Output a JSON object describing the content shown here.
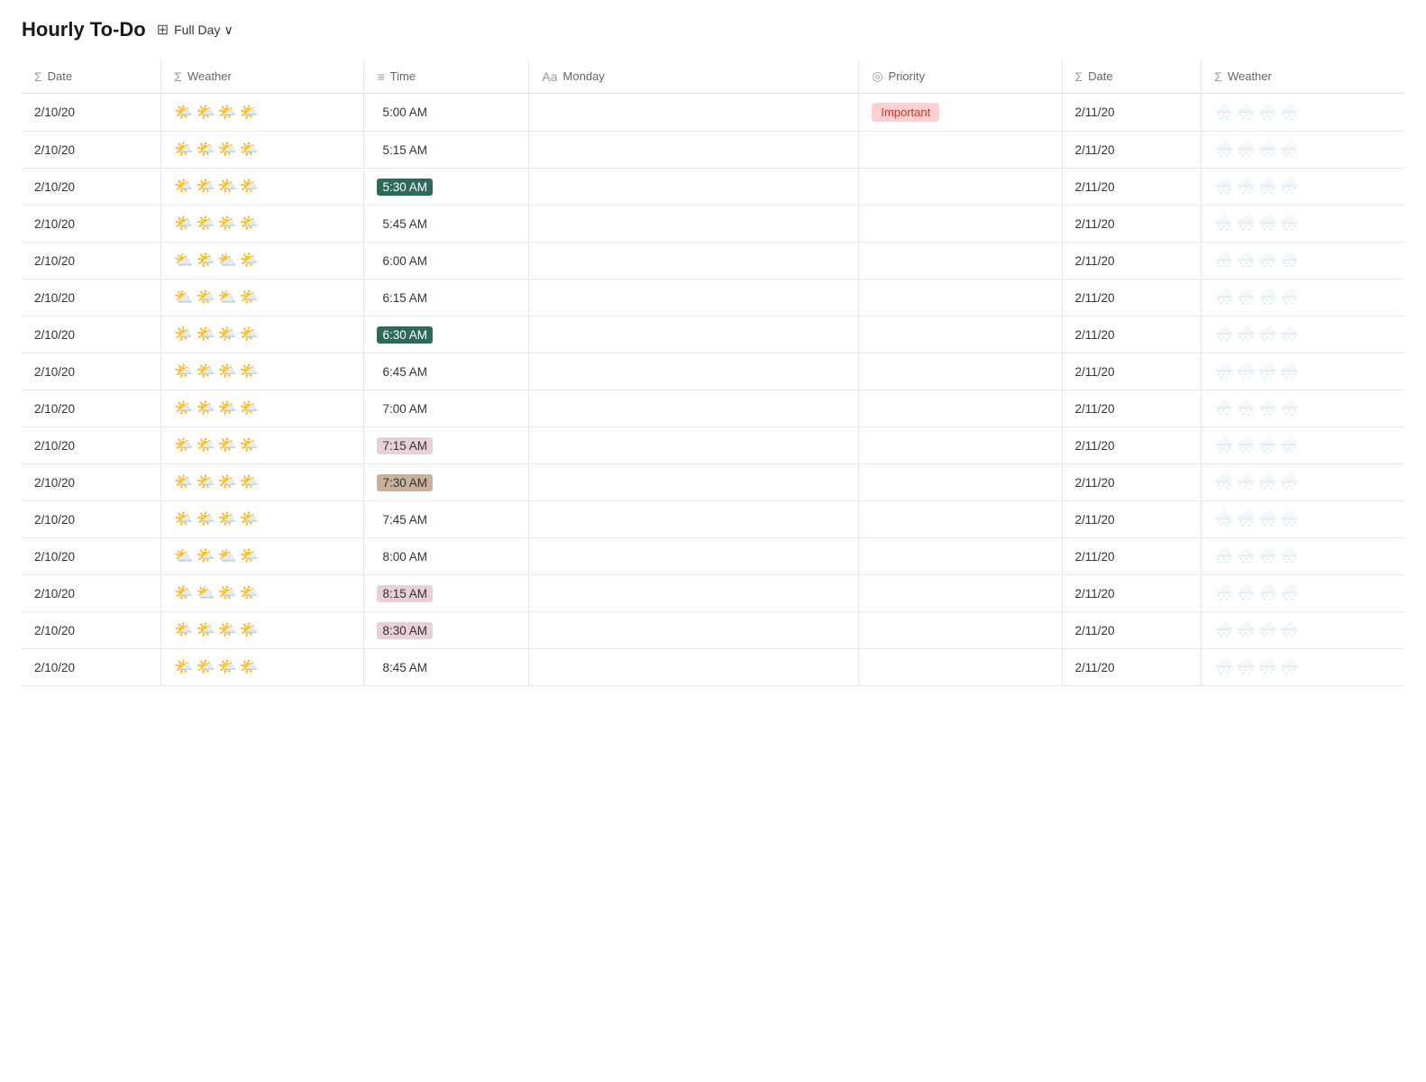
{
  "header": {
    "title": "Hourly To-Do",
    "grid_icon": "⊞",
    "view_label": "Full Day",
    "chevron": "∨"
  },
  "columns": [
    {
      "id": "date1",
      "icon": "Σ",
      "label": "Date"
    },
    {
      "id": "weather1",
      "icon": "Σ",
      "label": "Weather"
    },
    {
      "id": "time",
      "icon": "≡",
      "label": "Time"
    },
    {
      "id": "monday",
      "icon": "Aa",
      "label": "Monday"
    },
    {
      "id": "priority",
      "icon": "◎",
      "label": "Priority"
    },
    {
      "id": "date2",
      "icon": "Σ",
      "label": "Date"
    },
    {
      "id": "weather2",
      "icon": "Σ",
      "label": "Weather"
    }
  ],
  "rows": [
    {
      "date1": "2/10/20",
      "weather1": "sunny",
      "time": "5:00 AM",
      "time_style": "normal",
      "monday": "",
      "priority": "Important",
      "date2": "2/11/20",
      "weather2": "grey"
    },
    {
      "date1": "2/10/20",
      "weather1": "sunny",
      "time": "5:15 AM",
      "time_style": "normal",
      "monday": "",
      "priority": "",
      "date2": "2/11/20",
      "weather2": "grey"
    },
    {
      "date1": "2/10/20",
      "weather1": "sunny",
      "time": "5:30 AM",
      "time_style": "teal",
      "monday": "",
      "priority": "",
      "date2": "2/11/20",
      "weather2": "grey"
    },
    {
      "date1": "2/10/20",
      "weather1": "sunny",
      "time": "5:45 AM",
      "time_style": "normal",
      "monday": "",
      "priority": "",
      "date2": "2/11/20",
      "weather2": "grey"
    },
    {
      "date1": "2/10/20",
      "weather1": "cloudy",
      "time": "6:00 AM",
      "time_style": "normal",
      "monday": "",
      "priority": "",
      "date2": "2/11/20",
      "weather2": "grey"
    },
    {
      "date1": "2/10/20",
      "weather1": "cloudy",
      "time": "6:15 AM",
      "time_style": "normal",
      "monday": "",
      "priority": "",
      "date2": "2/11/20",
      "weather2": "grey"
    },
    {
      "date1": "2/10/20",
      "weather1": "sunny",
      "time": "6:30 AM",
      "time_style": "teal",
      "monday": "",
      "priority": "",
      "date2": "2/11/20",
      "weather2": "grey"
    },
    {
      "date1": "2/10/20",
      "weather1": "sunny",
      "time": "6:45 AM",
      "time_style": "normal",
      "monday": "",
      "priority": "",
      "date2": "2/11/20",
      "weather2": "grey"
    },
    {
      "date1": "2/10/20",
      "weather1": "sunny",
      "time": "7:00 AM",
      "time_style": "normal",
      "monday": "",
      "priority": "",
      "date2": "2/11/20",
      "weather2": "grey"
    },
    {
      "date1": "2/10/20",
      "weather1": "sunny",
      "time": "7:15 AM",
      "time_style": "pink",
      "monday": "",
      "priority": "",
      "date2": "2/11/20",
      "weather2": "grey"
    },
    {
      "date1": "2/10/20",
      "weather1": "sunny",
      "time": "7:30 AM",
      "time_style": "brown",
      "monday": "",
      "priority": "",
      "date2": "2/11/20",
      "weather2": "grey"
    },
    {
      "date1": "2/10/20",
      "weather1": "sunny",
      "time": "7:45 AM",
      "time_style": "normal",
      "monday": "",
      "priority": "",
      "date2": "2/11/20",
      "weather2": "grey"
    },
    {
      "date1": "2/10/20",
      "weather1": "cloudy",
      "time": "8:00 AM",
      "time_style": "normal",
      "monday": "",
      "priority": "",
      "date2": "2/11/20",
      "weather2": "grey"
    },
    {
      "date1": "2/10/20",
      "weather1": "mixed",
      "time": "8:15 AM",
      "time_style": "pink",
      "monday": "",
      "priority": "",
      "date2": "2/11/20",
      "weather2": "grey"
    },
    {
      "date1": "2/10/20",
      "weather1": "sunny",
      "time": "8:30 AM",
      "time_style": "pink",
      "monday": "",
      "priority": "",
      "date2": "2/11/20",
      "weather2": "grey"
    },
    {
      "date1": "2/10/20",
      "weather1": "sunny",
      "time": "8:45 AM",
      "time_style": "normal",
      "monday": "",
      "priority": "",
      "date2": "2/11/20",
      "weather2": "grey"
    }
  ]
}
